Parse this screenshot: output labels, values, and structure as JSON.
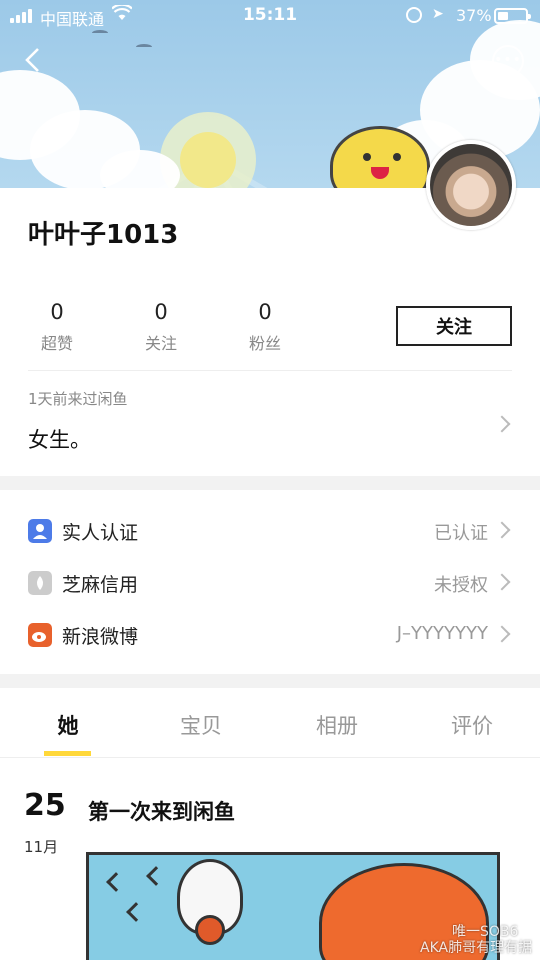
{
  "status_bar": {
    "carrier": "中国联通",
    "time": "15:11",
    "battery": "37%"
  },
  "header": {
    "back_icon": "chevron-left-icon",
    "more_icon": "more-dots-icon",
    "more_label": "•••"
  },
  "profile": {
    "username": "叶叶子1013",
    "stats": [
      {
        "value": "0",
        "label": "超赞"
      },
      {
        "value": "0",
        "label": "关注"
      },
      {
        "value": "0",
        "label": "粉丝"
      }
    ],
    "follow_label": "关注",
    "last_seen": "1天前来过闲鱼",
    "bio": "女生。"
  },
  "verifications": [
    {
      "icon": "person-verified-icon",
      "label": "实人认证",
      "value": "已认证",
      "color": "#4d7be8"
    },
    {
      "icon": "sesame-credit-icon",
      "label": "芝麻信用",
      "value": "未授权",
      "color": "#cccccc"
    },
    {
      "icon": "weibo-icon",
      "label": "新浪微博",
      "value": "J–YYYYYYY",
      "color": "#e8612c"
    }
  ],
  "tabs": [
    {
      "label": "她",
      "active": true
    },
    {
      "label": "宝贝",
      "active": false
    },
    {
      "label": "相册",
      "active": false
    },
    {
      "label": "评价",
      "active": false
    }
  ],
  "feed": {
    "day": "25",
    "month": "11月",
    "title": "第一次来到闲鱼"
  },
  "watermark": {
    "line1": "唯一SOB6",
    "line2": "AKA肺哥有理有据"
  },
  "colors": {
    "tab_underline": "#ffd83a",
    "banner_sky": "#a6cfe9"
  }
}
